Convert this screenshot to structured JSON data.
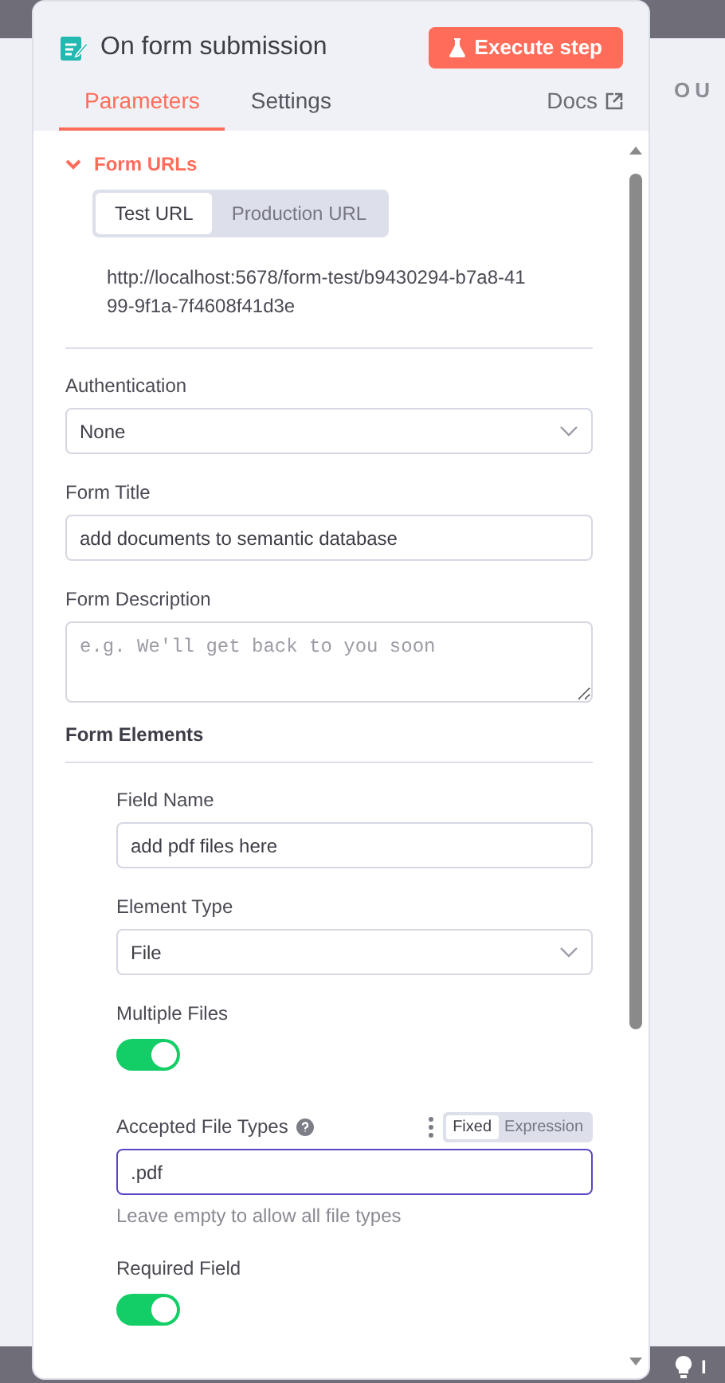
{
  "node": {
    "title": "On form submission",
    "execute_button": "Execute step"
  },
  "tabs": [
    {
      "label": "Parameters",
      "selected": true
    },
    {
      "label": "Settings",
      "selected": false
    }
  ],
  "docs_link": "Docs",
  "form_urls": {
    "title": "Form URLs",
    "expanded": true,
    "url_tabs": [
      {
        "label": "Test URL",
        "selected": true
      },
      {
        "label": "Production URL",
        "selected": false
      }
    ],
    "url": "http://localhost:5678/form-test/b9430294-b7a8-4199-9f1a-7f4608f41d3e"
  },
  "fields": [
    {
      "kind": "select",
      "label": "Authentication",
      "value": "None"
    },
    {
      "kind": "text",
      "label": "Form Title",
      "value": "add documents to semantic database"
    },
    {
      "kind": "textarea",
      "label": "Form Description",
      "placeholder": "e.g. We'll get back to you soon"
    }
  ],
  "section_title": "Form Elements",
  "element_fields": [
    {
      "kind": "text",
      "label": "Field Name",
      "value": "add pdf files here"
    },
    {
      "kind": "select",
      "label": "Element Type",
      "value": "File"
    },
    {
      "kind": "toggle",
      "label": "Multiple Files",
      "on": true
    },
    {
      "kind": "text",
      "label": "Accepted File Types",
      "value": ".pdf",
      "focused": true,
      "help": true,
      "mode_tabs": [
        {
          "label": "Fixed",
          "selected": true
        },
        {
          "label": "Expression",
          "selected": false
        }
      ],
      "hint": "Leave empty to allow all file types"
    },
    {
      "kind": "toggle",
      "label": "Required Field",
      "on": true
    }
  ],
  "output_label": "OU",
  "tip": "I"
}
